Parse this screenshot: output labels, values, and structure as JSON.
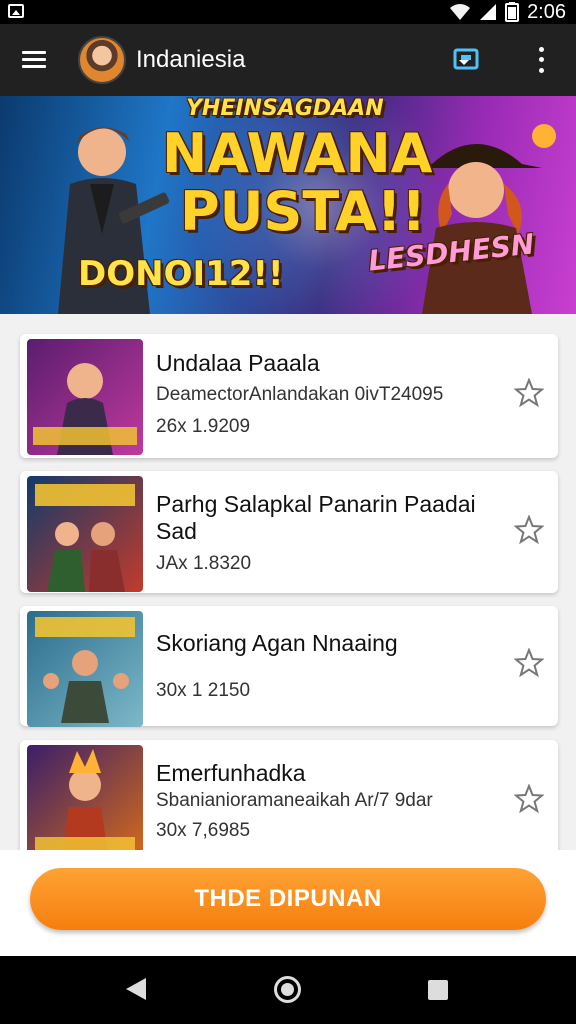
{
  "status_bar": {
    "time": "2:06",
    "icons": [
      "image-icon",
      "wifi-icon",
      "signal-icon",
      "battery-icon"
    ]
  },
  "app_bar": {
    "title": "Indaniesia",
    "icons": [
      "menu-icon",
      "avatar",
      "cast-icon",
      "more-vert-icon"
    ]
  },
  "banner": {
    "line1": "YHEINSAGDAAN",
    "line2": "NAWANA",
    "line3": "PUSTA!!",
    "line4": "DONOI12!!",
    "line5": "LESDHESN"
  },
  "items": [
    {
      "title": "Undalaa Paaala",
      "subtitle": "DeamectorAnlandakan 0ivT24095",
      "meta": "26x 1.9209",
      "thumb_text": "PANAKUMI",
      "thumb_colors": [
        "#5a1d6e",
        "#c0399e"
      ]
    },
    {
      "title": "Parhg Salapkal Panarin Paadai Sad",
      "subtitle": "",
      "meta": "JAx 1.8320",
      "thumb_text": "SALAPKAL",
      "thumb_colors": [
        "#123a6b",
        "#c23b2b"
      ]
    },
    {
      "title": "Skoriang Agan Nnaaing",
      "subtitle": "",
      "meta": "30x 1 2150",
      "thumb_text": "PANHNNAS",
      "thumb_colors": [
        "#2c6d8c",
        "#7cb8c9"
      ]
    },
    {
      "title": "Emerfunhadka",
      "subtitle": "Sbanianioramaneaikah Ar/7 9dar",
      "meta": "30x 7,6985",
      "thumb_text": "EMERFUN",
      "thumb_colors": [
        "#3a1f6a",
        "#d66b1a"
      ]
    }
  ],
  "cta": {
    "label": "THDE DIPUNAN"
  },
  "colors": {
    "app_bar": "#212121",
    "accent": "#f7901e",
    "cast": "#4fc3f7",
    "star": "#777777"
  }
}
